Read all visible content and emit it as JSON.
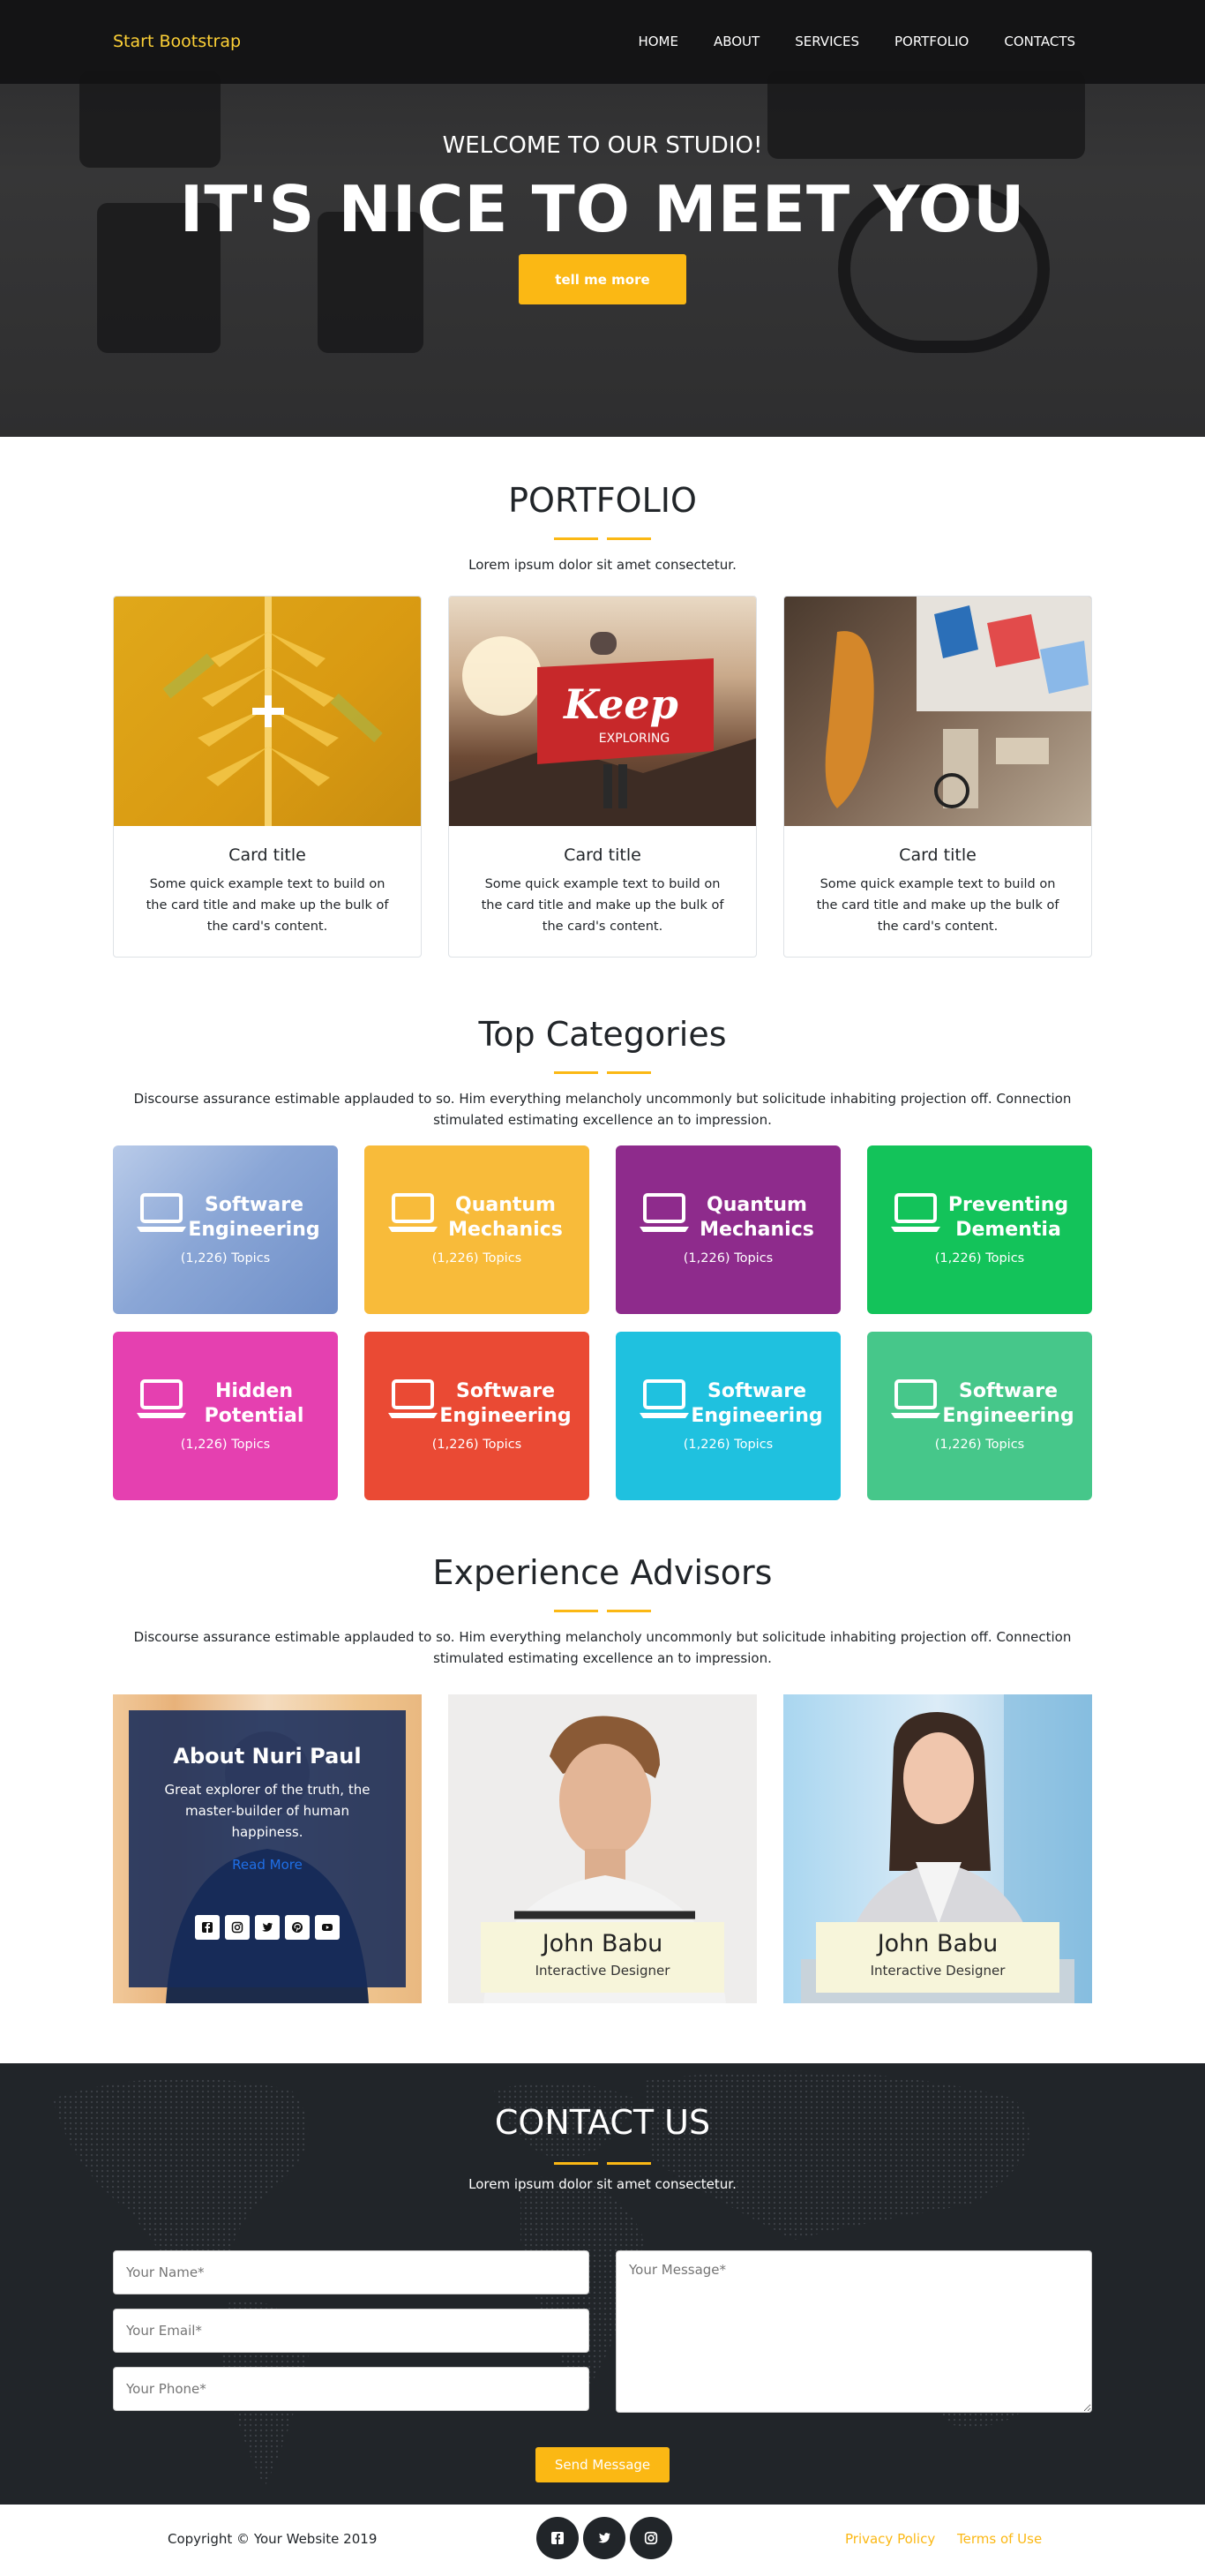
{
  "nav": {
    "brand": "Start Bootstrap",
    "links": [
      "HOME",
      "ABOUT",
      "SERVICES",
      "PORTFOLIO",
      "CONTACTS"
    ]
  },
  "hero": {
    "subtitle": "WELCOME TO OUR STUDIO!",
    "title": "IT'S NICE TO MEET YOU",
    "button": "tell me more"
  },
  "portfolio": {
    "title": "PORTFOLIO",
    "subtitle": "Lorem ipsum dolor sit amet consectetur.",
    "cards": [
      {
        "title": "Card title",
        "text": "Some quick example text to build on the card title and make up the bulk of the card's content."
      },
      {
        "title": "Card title",
        "text": "Some quick example text to build on the card title and make up the bulk of the card's content.",
        "flag_text": "Keep",
        "flag_sub": "EXPLORING"
      },
      {
        "title": "Card title",
        "text": "Some quick example text to build on the card title and make up the bulk of the card's content."
      }
    ]
  },
  "categories": {
    "title": "Top Categories",
    "subtitle": "Discourse assurance estimable applauded to so. Him everything melancholy uncommonly but solicitude inhabiting projection off. Connection stimulated estimating excellence an to impression.",
    "tiles": [
      {
        "name": "Software Engineering",
        "count": "(1,226) Topics",
        "color": "#8aa6d6"
      },
      {
        "name": "Quantum Mechanics",
        "count": "(1,226) Topics",
        "color": "#f8bb3a"
      },
      {
        "name": "Quantum Mechanics",
        "count": "(1,226) Topics",
        "color": "#8e2b8c"
      },
      {
        "name": "Preventing Dementia",
        "count": "(1,226) Topics",
        "color": "#13c35a"
      },
      {
        "name": "Hidden Potential",
        "count": "(1,226) Topics",
        "color": "#e540b0"
      },
      {
        "name": "Software Engineering",
        "count": "(1,226) Topics",
        "color": "#ea4a34"
      },
      {
        "name": "Software Engineering",
        "count": "(1,226) Topics",
        "color": "#1fc1df"
      },
      {
        "name": "Software Engineering",
        "count": "(1,226) Topics",
        "color": "#46c78a"
      }
    ]
  },
  "advisors": {
    "title": "Experience Advisors",
    "subtitle": "Discourse assurance estimable applauded to so. Him everything melancholy uncommonly but solicitude inhabiting projection off. Connection stimulated estimating excellence an to impression.",
    "featured": {
      "title": "About Nuri Paul",
      "text": "Great explorer of the truth, the master-builder of human happiness.",
      "link": "Read More",
      "socials": [
        "facebook-icon",
        "instagram-icon",
        "twitter-icon",
        "pinterest-icon",
        "youtube-icon"
      ]
    },
    "people": [
      {
        "name": "John Babu",
        "role": "Interactive Designer"
      },
      {
        "name": "John Babu",
        "role": "Interactive Designer"
      }
    ]
  },
  "contact": {
    "title": "CONTACT US",
    "subtitle": "Lorem ipsum dolor sit amet consectetur.",
    "name_placeholder": "Your Name*",
    "email_placeholder": "Your Email*",
    "phone_placeholder": "Your Phone*",
    "message_placeholder": "Your Message*",
    "send": "Send Message"
  },
  "footer": {
    "copyright": "Copyright © Your Website 2019",
    "socials": [
      "facebook-icon",
      "twitter-icon",
      "instagram-icon"
    ],
    "privacy": "Privacy Policy",
    "terms": "Terms of Use"
  },
  "colors": {
    "accent": "#fbb814",
    "dark": "#212529",
    "link": "#1f6fe6"
  }
}
